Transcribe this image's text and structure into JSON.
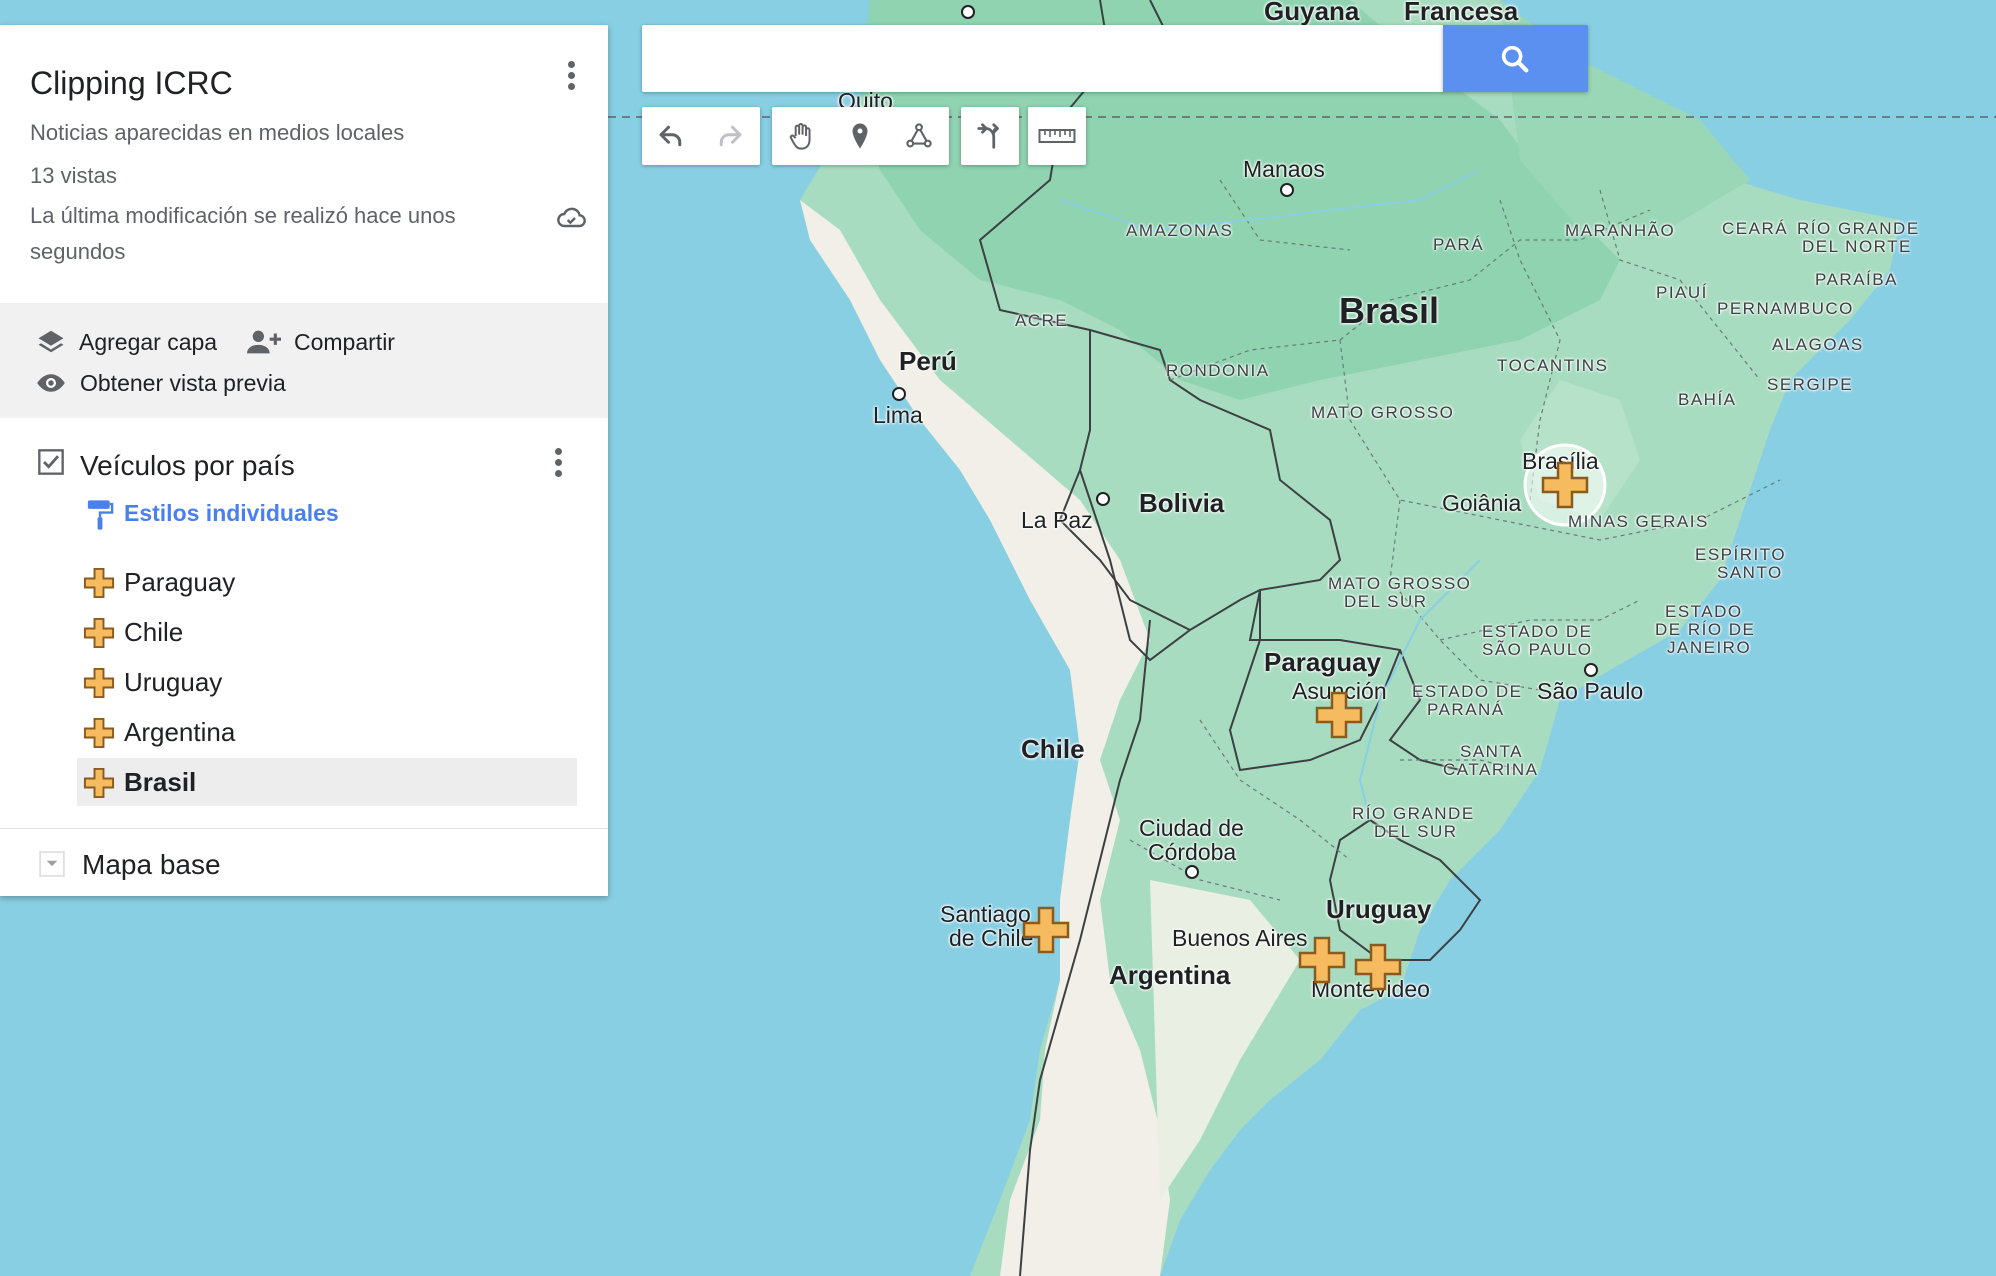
{
  "map": {
    "title": "Clipping ICRC",
    "description": "Noticias aparecidas en medios locales",
    "views": "13 vistas",
    "last_modified": "La última modificación se realizó hace unos segundos",
    "actions": {
      "add_layer": "Agregar capa",
      "share": "Compartir",
      "preview": "Obtener vista previa"
    },
    "layer": {
      "name": "Veículos por país",
      "style": "Estilos individuales",
      "items": [
        {
          "label": "Paraguay"
        },
        {
          "label": "Chile"
        },
        {
          "label": "Uruguay"
        },
        {
          "label": "Argentina"
        },
        {
          "label": "Brasil"
        }
      ],
      "selected_item": "Brasil"
    },
    "basemap": "Mapa base",
    "search": {
      "placeholder": ""
    }
  },
  "labels": {
    "countries": {
      "brasil": "Brasil",
      "peru": "Perú",
      "bolivia": "Bolivia",
      "paraguay": "Paraguay",
      "chile": "Chile",
      "argentina": "Argentina",
      "uruguay": "Uruguay",
      "guyana": "Guyana",
      "francesa": "Francesa"
    },
    "cities": {
      "quito": "Quito",
      "manaos": "Manaos",
      "lima": "Lima",
      "la_paz": "La Paz",
      "goiania": "Goiânia",
      "brasilia": "Brasília",
      "asuncion": "Asunción",
      "sao_paulo": "São Paulo",
      "cordoba_1": "Ciudad de",
      "cordoba_2": "Córdoba",
      "santiago_1": "Santiago",
      "santiago_2": "de Chile",
      "buenos_aires": "Buenos Aires",
      "montevideo": "Montevideo"
    },
    "states": {
      "amazonas": "AMAZONAS",
      "para": "PARÁ",
      "maranhao": "MARANHÃO",
      "ceara": "CEARÁ",
      "rio_grande_norte_1": "RÍO GRANDE",
      "rio_grande_norte_2": "DEL NORTE",
      "paraiba": "PARAÍBA",
      "piaui": "PIAUÍ",
      "pernambuco": "PERNAMBUCO",
      "acre": "ACRE",
      "alagoas": "ALAGOAS",
      "rondonia": "RONDONIA",
      "tocantins": "TOCANTINS",
      "sergipe": "SERGIPE",
      "mato_grosso": "MATO GROSSO",
      "bahia": "BAHÍA",
      "minas_gerais": "MINAS GERAIS",
      "espirito_santo_1": "ESPÍRITO",
      "espirito_santo_2": "SANTO",
      "mato_grosso_sur_1": "MATO GROSSO",
      "mato_grosso_sur_2": "DEL SUR",
      "rio_janeiro_1": "ESTADO",
      "rio_janeiro_2": "DE RÍO DE",
      "rio_janeiro_3": "JANEIRO",
      "sao_paulo_1": "ESTADO DE",
      "sao_paulo_2": "SÃO PAULO",
      "parana_1": "ESTADO DE",
      "parana_2": "PARANÁ",
      "santa_catarina_1": "SANTA",
      "santa_catarina_2": "CATARINA",
      "rio_grande_sur_1": "RÍO GRANDE",
      "rio_grande_sur_2": "DEL SUR"
    }
  },
  "colors": {
    "ocean": "#89cfe3",
    "land": "#a8dcc0",
    "forest": "#8fd3b0",
    "andes": "#f1efe7",
    "marker": "#f6bb5e",
    "accent": "#4a80ec",
    "search_button": "#5b8ff0"
  },
  "icons": [
    "search-icon",
    "undo-icon",
    "redo-icon",
    "hand-icon",
    "marker-icon",
    "line-icon",
    "route-icon",
    "ruler-icon",
    "more-vert-icon",
    "cloud-saved-icon",
    "layers-icon",
    "person-add-icon",
    "eye-icon",
    "checkbox-icon",
    "paint-roller-icon",
    "plus-marker-icon",
    "dropdown-icon"
  ]
}
